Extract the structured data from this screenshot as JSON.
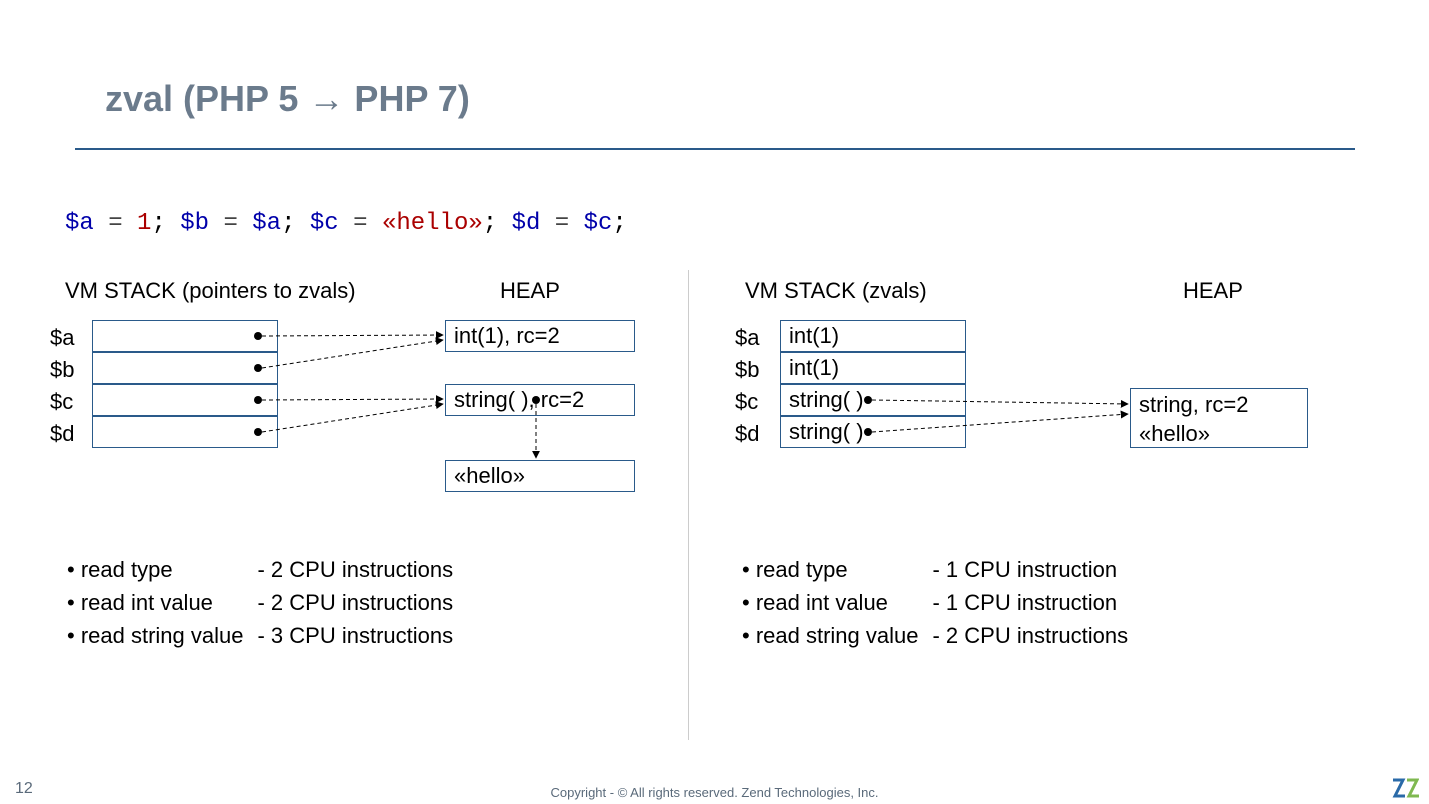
{
  "title": "zval (PHP 5 → PHP 7)",
  "code": {
    "a": "$a",
    "b": "$b",
    "c": "$c",
    "d": "$d",
    "eq": " = ",
    "one": "1",
    "hello": "«hello»",
    "semi": "; "
  },
  "left": {
    "stack_header": "VM STACK (pointers to zvals)",
    "heap_header": "HEAP",
    "vars": [
      "$a",
      "$b",
      "$c",
      "$d"
    ],
    "heap_int": "int(1), rc=2",
    "heap_str": "string( ), rc=2",
    "hello": "«hello»"
  },
  "right": {
    "stack_header": "VM STACK (zvals)",
    "heap_header": "HEAP",
    "vars": [
      "$a",
      "$b",
      "$c",
      "$d"
    ],
    "cells": [
      "int(1)",
      "int(1)",
      "string(  )",
      "string(  )"
    ],
    "heap_l1": "string, rc=2",
    "heap_l2": "«hello»"
  },
  "left_bullets": [
    [
      "read type",
      "- 2 CPU instructions"
    ],
    [
      "read int value",
      "- 2 CPU instructions"
    ],
    [
      "read string value",
      "- 3 CPU instructions"
    ]
  ],
  "right_bullets": [
    [
      "read type",
      "- 1 CPU instruction"
    ],
    [
      "read int value",
      "- 1 CPU instruction"
    ],
    [
      "read string value",
      "- 2 CPU instructions"
    ]
  ],
  "footer": "Copyright - © All rights reserved. Zend Technologies, Inc.",
  "page": "12"
}
